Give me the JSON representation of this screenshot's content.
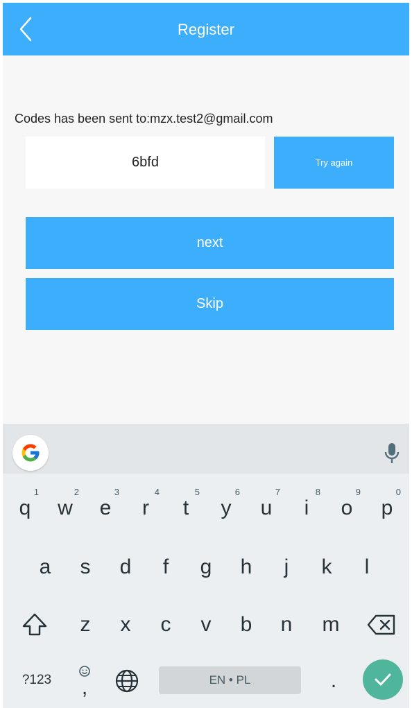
{
  "header": {
    "title": "Register",
    "back_icon": "back-chevron-icon"
  },
  "verification": {
    "sent_text": "Codes has been sent to:mzx.test2@gmail.com",
    "code_value": "6bfd",
    "try_again_label": "Try again"
  },
  "actions": {
    "next_label": "next",
    "skip_label": "Skip"
  },
  "keyboard": {
    "row1": [
      {
        "k": "q",
        "h": "1"
      },
      {
        "k": "w",
        "h": "2"
      },
      {
        "k": "e",
        "h": "3"
      },
      {
        "k": "r",
        "h": "4"
      },
      {
        "k": "t",
        "h": "5"
      },
      {
        "k": "y",
        "h": "6"
      },
      {
        "k": "u",
        "h": "7"
      },
      {
        "k": "i",
        "h": "8"
      },
      {
        "k": "o",
        "h": "9"
      },
      {
        "k": "p",
        "h": "0"
      }
    ],
    "row2": [
      "a",
      "s",
      "d",
      "f",
      "g",
      "h",
      "j",
      "k",
      "l"
    ],
    "row3": [
      "z",
      "x",
      "c",
      "v",
      "b",
      "n",
      "m"
    ],
    "sym_label": "?123",
    "comma_label": ",",
    "period_label": ".",
    "space_label": "EN • PL"
  },
  "colors": {
    "accent": "#3caefb",
    "enter": "#4fb59b"
  }
}
